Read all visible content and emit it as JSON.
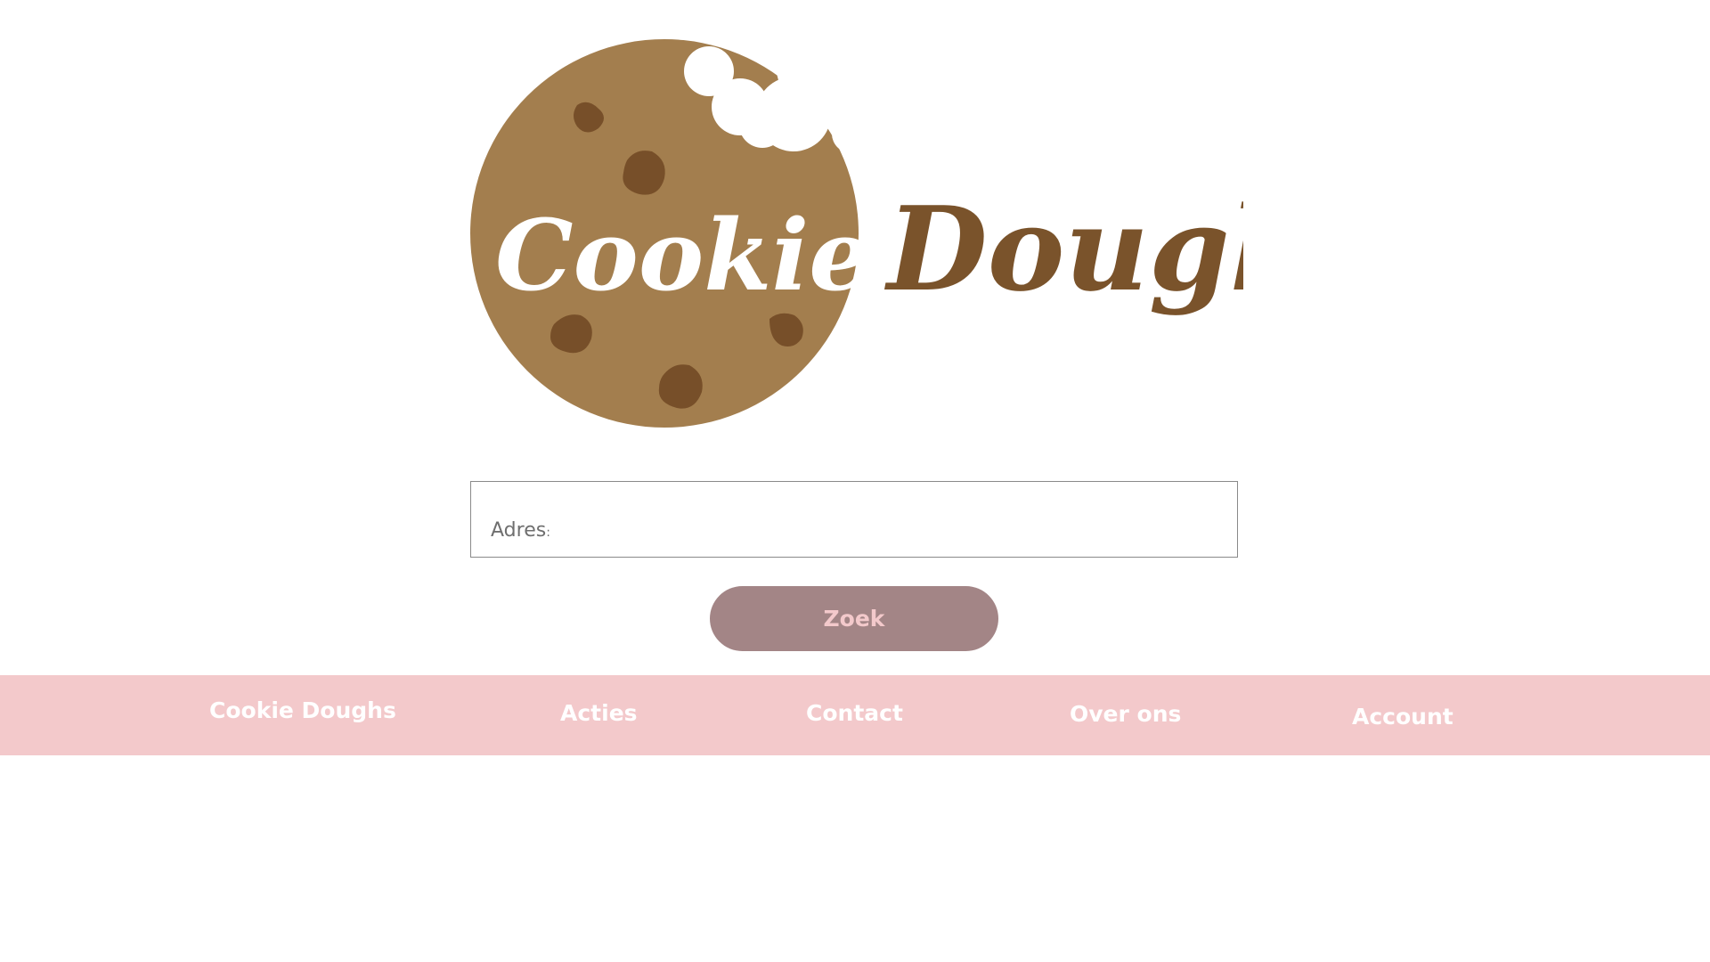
{
  "logo": {
    "word1": "Cookie",
    "word2": "Dough",
    "icon": "cookie-icon"
  },
  "search": {
    "label": "Adres",
    "label_colon": ":",
    "value": "",
    "placeholder": "",
    "button_label": "Zoek"
  },
  "nav": {
    "items": [
      {
        "label": "Cookie Doughs"
      },
      {
        "label": "Acties"
      },
      {
        "label": "Contact"
      },
      {
        "label": "Over ons"
      },
      {
        "label": "Account"
      }
    ]
  },
  "colors": {
    "cookie": "#a37e4e",
    "chip": "#774f29",
    "dough_text": "#7a532b",
    "button": "#a38586",
    "button_text": "#f3c9cb",
    "navbar": "#f3c9cb",
    "nav_text": "#ffffff"
  }
}
